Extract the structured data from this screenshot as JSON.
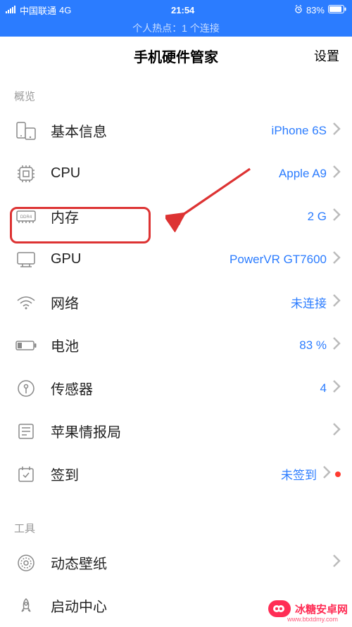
{
  "status": {
    "carrier": "中国联通",
    "network": "4G",
    "time": "21:54",
    "battery_pct": "83%"
  },
  "hotspot": "个人热点：1 个连接",
  "nav": {
    "title": "手机硬件管家",
    "settings": "设置"
  },
  "section_overview": "概览",
  "section_tools": "工具",
  "rows": {
    "basic": {
      "label": "基本信息",
      "value": "iPhone 6S"
    },
    "cpu": {
      "label": "CPU",
      "value": "Apple A9"
    },
    "memory": {
      "label": "内存",
      "value": "2 G"
    },
    "gpu": {
      "label": "GPU",
      "value": "PowerVR GT7600"
    },
    "network": {
      "label": "网络",
      "value": "未连接"
    },
    "battery": {
      "label": "电池",
      "value": "83 %"
    },
    "sensors": {
      "label": "传感器",
      "value": "4"
    },
    "intel": {
      "label": "苹果情报局",
      "value": ""
    },
    "checkin": {
      "label": "签到",
      "value": "未签到"
    },
    "wallpaper": {
      "label": "动态壁纸",
      "value": ""
    },
    "launch": {
      "label": "启动中心",
      "value": ""
    }
  },
  "watermark": {
    "brand": "冰糖安卓网",
    "url": "www.btxtdmy.com"
  }
}
